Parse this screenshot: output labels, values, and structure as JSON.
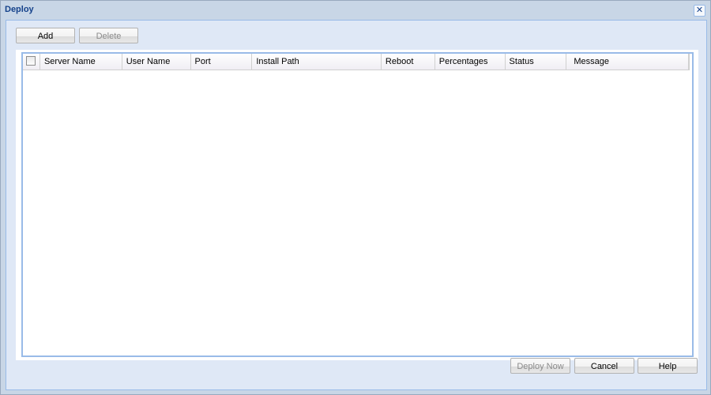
{
  "window": {
    "title": "Deploy",
    "close_icon": "close-icon"
  },
  "toolbar": {
    "add_label": "Add",
    "delete_label": "Delete"
  },
  "grid": {
    "columns": [
      {
        "label": "Server Name"
      },
      {
        "label": "User Name"
      },
      {
        "label": "Port"
      },
      {
        "label": "Install Path"
      },
      {
        "label": "Reboot"
      },
      {
        "label": "Percentages"
      },
      {
        "label": "Status"
      },
      {
        "label": "Message"
      }
    ],
    "rows": []
  },
  "footer": {
    "deploy_now_label": "Deploy Now",
    "cancel_label": "Cancel",
    "help_label": "Help"
  }
}
